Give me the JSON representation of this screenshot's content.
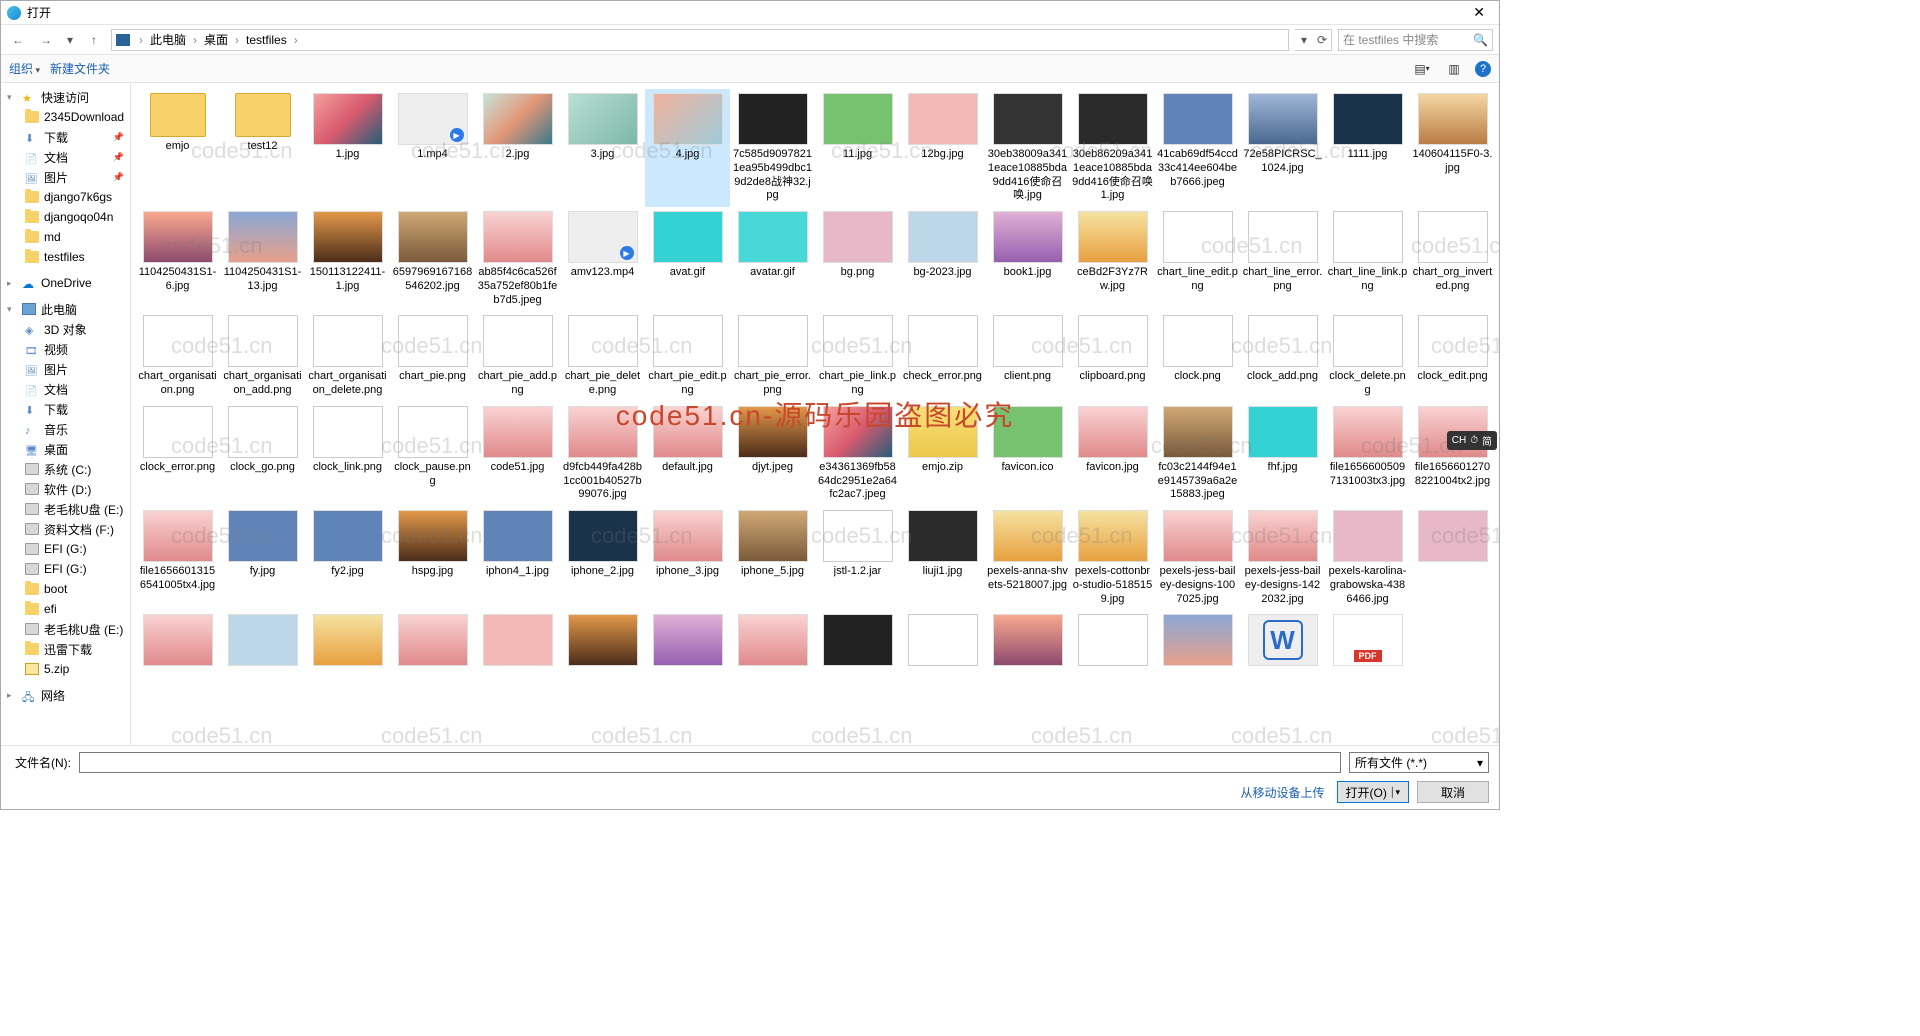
{
  "window": {
    "title": "打开"
  },
  "nav": {
    "back_icon": "←",
    "fwd_icon": "→",
    "dropdown_icon": "▾",
    "up_icon": "↑",
    "refresh_icon": "⟳"
  },
  "breadcrumb": {
    "items": [
      "此电脑",
      "桌面",
      "testfiles"
    ]
  },
  "search": {
    "placeholder": "在 testfiles 中搜索"
  },
  "toolbar": {
    "organize": "组织",
    "newfolder": "新建文件夹",
    "help_tooltip": "?"
  },
  "sidebar": {
    "groups": [
      {
        "label": "快速访问",
        "icon": "star",
        "expand": true,
        "items": [
          {
            "label": "2345Download",
            "icon": "folder",
            "pin": true
          },
          {
            "label": "下载",
            "icon": "special dl",
            "pin": true
          },
          {
            "label": "文档",
            "icon": "special doc",
            "pin": true
          },
          {
            "label": "图片",
            "icon": "special pic",
            "pin": true
          },
          {
            "label": "django7k6gs",
            "icon": "folder"
          },
          {
            "label": "djangoqo04n",
            "icon": "folder"
          },
          {
            "label": "md",
            "icon": "folder"
          },
          {
            "label": "testfiles",
            "icon": "folder"
          }
        ]
      },
      {
        "label": "OneDrive",
        "icon": "cloud",
        "expand": false,
        "items": []
      },
      {
        "label": "此电脑",
        "icon": "pc",
        "expand": true,
        "items": [
          {
            "label": "3D 对象",
            "icon": "special d3"
          },
          {
            "label": "视频",
            "icon": "special vid"
          },
          {
            "label": "图片",
            "icon": "special pic"
          },
          {
            "label": "文档",
            "icon": "special doc"
          },
          {
            "label": "下载",
            "icon": "special dl"
          },
          {
            "label": "音乐",
            "icon": "special mus"
          },
          {
            "label": "桌面",
            "icon": "special desk"
          },
          {
            "label": "系统 (C:)",
            "icon": "drive"
          },
          {
            "label": "软件 (D:)",
            "icon": "drive"
          },
          {
            "label": "老毛桃U盘 (E:)",
            "icon": "drive"
          },
          {
            "label": "资料文档 (F:)",
            "icon": "drive"
          },
          {
            "label": "EFI (G:)",
            "icon": "drive"
          },
          {
            "label": "EFI (G:)",
            "icon": "drive"
          },
          {
            "label": "boot",
            "icon": "folder"
          },
          {
            "label": "efi",
            "icon": "folder"
          },
          {
            "label": "老毛桃U盘 (E:)",
            "icon": "drive"
          },
          {
            "label": "迅雷下载",
            "icon": "folder"
          },
          {
            "label": "5.zip",
            "icon": "zip"
          }
        ]
      },
      {
        "label": "网络",
        "icon": "net",
        "expand": false,
        "items": []
      }
    ]
  },
  "files": [
    {
      "name": "emjo",
      "type": "folder"
    },
    {
      "name": "test12",
      "type": "folder"
    },
    {
      "name": "1.jpg",
      "type": "img",
      "cls": "c1"
    },
    {
      "name": "1.mp4",
      "type": "video"
    },
    {
      "name": "2.jpg",
      "type": "img",
      "cls": "c2"
    },
    {
      "name": "3.jpg",
      "type": "img",
      "cls": "c3"
    },
    {
      "name": "4.jpg",
      "type": "img",
      "cls": "c4",
      "selected": true
    },
    {
      "name": "7c585d90978211ea95b499dbc19d2de8战神32.jpg",
      "type": "img",
      "cls": "c5"
    },
    {
      "name": "11.jpg",
      "type": "img",
      "cls": "c6"
    },
    {
      "name": "12bg.jpg",
      "type": "img",
      "cls": "c7"
    },
    {
      "name": "30eb38009a3411eace10885bda9dd416使命召唤.jpg",
      "type": "img",
      "cls": "c11"
    },
    {
      "name": "30eb86209a3411eace10885bda9dd416使命召唤1.jpg",
      "type": "img",
      "cls": "c12"
    },
    {
      "name": "41cab69df54ccd33c414ee604beb7666.jpeg",
      "type": "img",
      "cls": "c8"
    },
    {
      "name": "72e58PICRSC_1024.jpg",
      "type": "img",
      "cls": "c16"
    },
    {
      "name": "1111.jpg",
      "type": "img",
      "cls": "c13"
    },
    {
      "name": "140604115F0-3.jpg",
      "type": "img",
      "cls": "c14"
    },
    {
      "name": "1104250431S1-6.jpg",
      "type": "img",
      "cls": "c9"
    },
    {
      "name": "1104250431S1-13.jpg",
      "type": "img",
      "cls": "c10"
    },
    {
      "name": "150113122411-1.jpg",
      "type": "img",
      "cls": "c15"
    },
    {
      "name": "6597969167168546202.jpg",
      "type": "img",
      "cls": "c17"
    },
    {
      "name": "ab85f4c6ca526f35a752ef80b1feb7d5.jpeg",
      "type": "img",
      "cls": "c18"
    },
    {
      "name": "amv123.mp4",
      "type": "video"
    },
    {
      "name": "avat.gif",
      "type": "img",
      "cls": "c19"
    },
    {
      "name": "avatar.gif",
      "type": "img",
      "cls": "c20"
    },
    {
      "name": "bg.png",
      "type": "img",
      "cls": "c21"
    },
    {
      "name": "bg-2023.jpg",
      "type": "img",
      "cls": "c22"
    },
    {
      "name": "book1.jpg",
      "type": "img",
      "cls": "c24"
    },
    {
      "name": "ceBd2F3Yz7Rw.jpg",
      "type": "img",
      "cls": "c23"
    },
    {
      "name": "chart_line_edit.png",
      "type": "doc"
    },
    {
      "name": "chart_line_error.png",
      "type": "doc"
    },
    {
      "name": "chart_line_link.png",
      "type": "doc"
    },
    {
      "name": "chart_org_inverted.png",
      "type": "doc"
    },
    {
      "name": "chart_organisation.png",
      "type": "doc"
    },
    {
      "name": "chart_organisation_add.png",
      "type": "doc"
    },
    {
      "name": "chart_organisation_delete.png",
      "type": "doc"
    },
    {
      "name": "chart_pie.png",
      "type": "doc"
    },
    {
      "name": "chart_pie_add.png",
      "type": "doc"
    },
    {
      "name": "chart_pie_delete.png",
      "type": "doc"
    },
    {
      "name": "chart_pie_edit.png",
      "type": "doc"
    },
    {
      "name": "chart_pie_error.png",
      "type": "doc"
    },
    {
      "name": "chart_pie_link.png",
      "type": "doc"
    },
    {
      "name": "check_error.png",
      "type": "doc"
    },
    {
      "name": "client.png",
      "type": "doc"
    },
    {
      "name": "clipboard.png",
      "type": "doc"
    },
    {
      "name": "clock.png",
      "type": "doc"
    },
    {
      "name": "clock_add.png",
      "type": "doc"
    },
    {
      "name": "clock_delete.png",
      "type": "doc"
    },
    {
      "name": "clock_edit.png",
      "type": "doc"
    },
    {
      "name": "clock_error.png",
      "type": "doc"
    },
    {
      "name": "clock_go.png",
      "type": "doc"
    },
    {
      "name": "clock_link.png",
      "type": "doc"
    },
    {
      "name": "clock_pause.png",
      "type": "doc"
    },
    {
      "name": "code51.jpg",
      "type": "img",
      "cls": "c18"
    },
    {
      "name": "d9fcb449fa428b1cc001b40527b99076.jpg",
      "type": "img",
      "cls": "c18"
    },
    {
      "name": "default.jpg",
      "type": "img",
      "cls": "c18"
    },
    {
      "name": "djyt.jpeg",
      "type": "img",
      "cls": "c15"
    },
    {
      "name": "e34361369fb5864dc2951e2a64fc2ac7.jpeg",
      "type": "img",
      "cls": "c1"
    },
    {
      "name": "emjo.zip",
      "type": "zip"
    },
    {
      "name": "favicon.ico",
      "type": "img",
      "cls": "c6"
    },
    {
      "name": "favicon.jpg",
      "type": "img",
      "cls": "c18"
    },
    {
      "name": "fc03c2144f94e1e9145739a6a2e15883.jpeg",
      "type": "img",
      "cls": "c17"
    },
    {
      "name": "fhf.jpg",
      "type": "img",
      "cls": "c19"
    },
    {
      "name": "file16566005097131003tx3.jpg",
      "type": "img",
      "cls": "c18"
    },
    {
      "name": "file16566012708221004tx2.jpg",
      "type": "img",
      "cls": "c18"
    },
    {
      "name": "file16566013156541005tx4.jpg",
      "type": "img",
      "cls": "c18"
    },
    {
      "name": "fy.jpg",
      "type": "img",
      "cls": "c8"
    },
    {
      "name": "fy2.jpg",
      "type": "img",
      "cls": "c8"
    },
    {
      "name": "hspg.jpg",
      "type": "img",
      "cls": "c15"
    },
    {
      "name": "iphon4_1.jpg",
      "type": "img",
      "cls": "c8"
    },
    {
      "name": "iphone_2.jpg",
      "type": "img",
      "cls": "c13"
    },
    {
      "name": "iphone_3.jpg",
      "type": "img",
      "cls": "c18"
    },
    {
      "name": "iphone_5.jpg",
      "type": "img",
      "cls": "c17"
    },
    {
      "name": "jstl-1.2.jar",
      "type": "generic"
    },
    {
      "name": "liuji1.jpg",
      "type": "img",
      "cls": "c12"
    },
    {
      "name": "pexels-anna-shvets-5218007.jpg",
      "type": "img",
      "cls": "c23"
    },
    {
      "name": "pexels-cottonbro-studio-5185159.jpg",
      "type": "img",
      "cls": "c23"
    },
    {
      "name": "pexels-jess-bailey-designs-1007025.jpg",
      "type": "img",
      "cls": "c18"
    },
    {
      "name": "pexels-jess-bailey-designs-1422032.jpg",
      "type": "img",
      "cls": "c18"
    },
    {
      "name": "pexels-karolina-grabowska-4386466.jpg",
      "type": "img",
      "cls": "c21"
    },
    {
      "name": "",
      "type": "img",
      "cls": "c21"
    },
    {
      "name": "",
      "type": "img",
      "cls": "c18"
    },
    {
      "name": "",
      "type": "img",
      "cls": "c22"
    },
    {
      "name": "",
      "type": "img",
      "cls": "c23"
    },
    {
      "name": "",
      "type": "img",
      "cls": "c18"
    },
    {
      "name": "",
      "type": "img",
      "cls": "c7"
    },
    {
      "name": "",
      "type": "img",
      "cls": "c15"
    },
    {
      "name": "",
      "type": "img",
      "cls": "c24"
    },
    {
      "name": "",
      "type": "img",
      "cls": "c18"
    },
    {
      "name": "",
      "type": "img",
      "cls": "c5"
    },
    {
      "name": "",
      "type": "generic"
    },
    {
      "name": "",
      "type": "img",
      "cls": "c9"
    },
    {
      "name": "",
      "type": "generic"
    },
    {
      "name": "",
      "type": "img",
      "cls": "c10"
    },
    {
      "name": "",
      "type": "word"
    },
    {
      "name": "",
      "type": "pdf"
    }
  ],
  "footer": {
    "filename_label": "文件名(N):",
    "filter_text": "所有文件 (*.*)",
    "mobile_hint": "从移动设备上传",
    "open_btn": "打开(O)",
    "cancel_btn": "取消"
  },
  "ime": {
    "label": "CH",
    "icon": "⏱",
    "mode": "简"
  },
  "watermark": {
    "small": "code51.cn",
    "big": "code51.cn-源码乐园盗图必究"
  }
}
